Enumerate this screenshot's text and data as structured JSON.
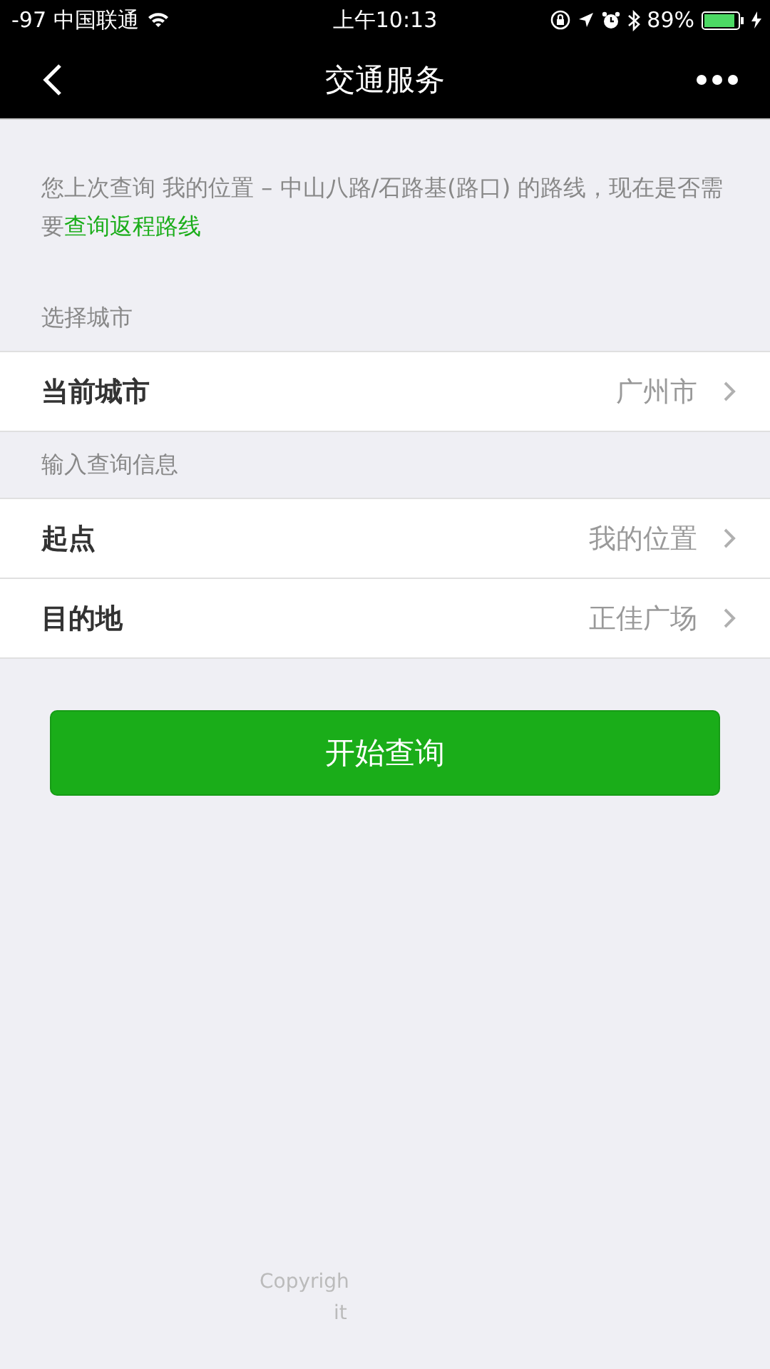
{
  "status_bar": {
    "signal": "-97",
    "carrier": "中国联通",
    "time": "上午10:13",
    "battery": "89%"
  },
  "nav": {
    "title": "交通服务"
  },
  "notice": {
    "text": "您上次查询 我的位置 – 中山八路/石路基(路口) 的路线，现在是否需要",
    "link": "查询返程路线"
  },
  "sections": [
    {
      "header": "选择城市",
      "rows": [
        {
          "label": "当前城市",
          "value": "广州市"
        }
      ]
    },
    {
      "header": "输入查询信息",
      "rows": [
        {
          "label": "起点",
          "value": "我的位置"
        },
        {
          "label": "目的地",
          "value": "正佳广场"
        }
      ]
    }
  ],
  "button": "开始查询",
  "footer": [
    "Copyrigh",
    "it"
  ]
}
